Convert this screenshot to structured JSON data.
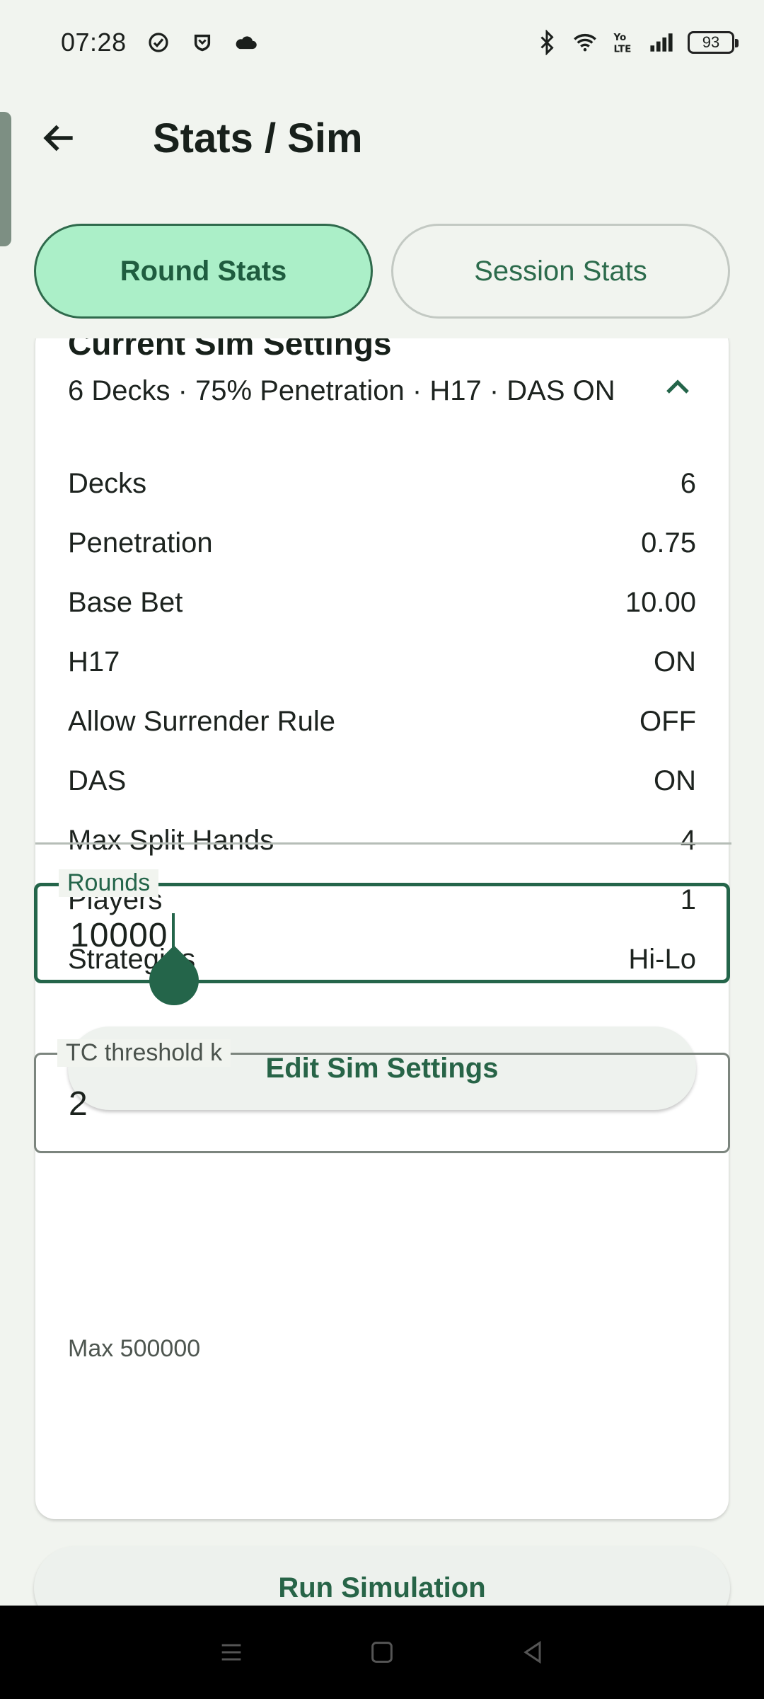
{
  "status_bar": {
    "time": "07:28",
    "battery": "93",
    "left_icons": [
      "check-circle-icon",
      "shield-icon",
      "cloud-icon"
    ],
    "right_icons": [
      "bluetooth-icon",
      "wifi-icon",
      "volte-icon",
      "signal-icon",
      "battery-icon"
    ]
  },
  "app_bar": {
    "title": "Stats / Sim",
    "back_icon": "arrow-left-icon"
  },
  "tabs": [
    {
      "label": "Round Stats",
      "active": true
    },
    {
      "label": "Session Stats",
      "active": false
    }
  ],
  "sim_card": {
    "title": "Current Sim Settings",
    "summary": "6 Decks · 75% Penetration · H17 · DAS ON",
    "collapse_icon": "chevron-up-icon",
    "rows": [
      {
        "label": "Decks",
        "value": "6"
      },
      {
        "label": "Penetration",
        "value": "0.75"
      },
      {
        "label": "Base Bet",
        "value": "10.00"
      },
      {
        "label": "H17",
        "value": "ON"
      },
      {
        "label": "Allow Surrender Rule",
        "value": "OFF"
      },
      {
        "label": "DAS",
        "value": "ON"
      },
      {
        "label": "Max Split Hands",
        "value": "4"
      },
      {
        "label": "Players",
        "value": "1"
      },
      {
        "label": "Strategies",
        "value": "Hi-Lo"
      }
    ],
    "edit_button": "Edit Sim Settings"
  },
  "rounds_field": {
    "label": "Rounds",
    "value": "10000",
    "helper": "Max 500000"
  },
  "tc_field": {
    "label": "TC threshold k",
    "value": "2"
  },
  "run_button": "Run Simulation",
  "colors": {
    "accent": "#24654a",
    "active_tab_bg": "#abefc8",
    "background": "#f1f4ef"
  }
}
